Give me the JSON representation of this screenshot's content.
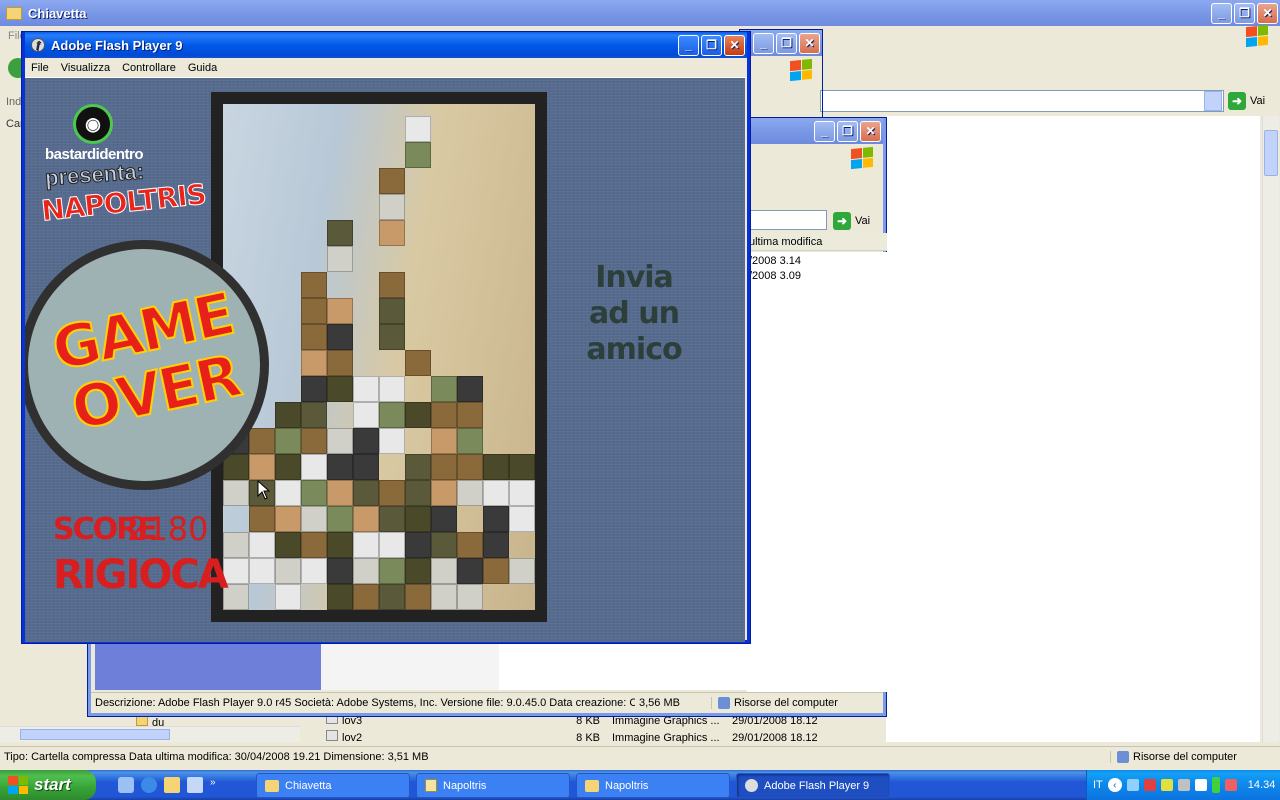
{
  "chiavetta": {
    "title": "Chiavetta",
    "menu_partial": "File",
    "addr_label": "Indi",
    "tab_partial": "Car",
    "go_label": "Vai",
    "rows": [
      {
        "name": "lov3",
        "size": "8 KB",
        "type": "Immagine Graphics ...",
        "date": "29/01/2008 18.12"
      },
      {
        "name": "lov2",
        "size": "8 KB",
        "type": "Immagine Graphics ...",
        "date": "29/01/2008 18.12"
      }
    ],
    "tree_item": "du",
    "status_text": "Tipo: Cartella compressa Data ultima modifica: 30/04/2008 19.21 Dimensione: 3,51 MB",
    "status_location": "Risorse del computer"
  },
  "napoltris_folder": {
    "go_label": "Vai",
    "col_modified": "ultima modifica",
    "dates": [
      "/2008 3.14",
      "/2008 3.09"
    ],
    "status_text": "Descrizione: Adobe Flash Player 9.0 r45 Società: Adobe Systems, Inc. Versione file: 9.0.45.0 Data creazione: C",
    "status_size": "3,56 MB",
    "status_location": "Risorse del computer"
  },
  "flash": {
    "title": "Adobe Flash Player 9",
    "menu": [
      "File",
      "Visualizza",
      "Controllare",
      "Guida"
    ]
  },
  "game": {
    "brand": "bastardidentro",
    "presenta": "presenta:",
    "game_title": "NAPOLTRIS",
    "game_over_1": "GAME",
    "game_over_2": "OVER",
    "score_label": "SCORE",
    "score_value": "2180",
    "replay": "RIGIOCA",
    "send_1": "Invia",
    "send_2": "ad un amico"
  },
  "taskbar": {
    "start": "start",
    "tasks": [
      "Chiavetta",
      "Napoltris",
      "Napoltris",
      "Adobe Flash Player 9"
    ],
    "lang": "IT",
    "clock": "14.34"
  },
  "colors": {
    "xp_blue": "#0831d9",
    "game_red": "#e8201a",
    "flash_bg": "#566b8e"
  }
}
